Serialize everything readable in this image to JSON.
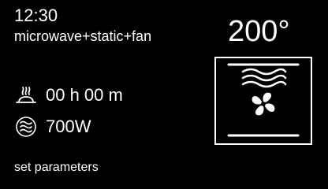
{
  "status": {
    "time": "12:30",
    "mode": "microwave+static+fan",
    "temperature": "200°"
  },
  "settings": {
    "duration": "00 h 00 m",
    "power": "700W"
  },
  "footer": {
    "hint": "set parameters"
  },
  "icons": {
    "duration": "dish-timer-icon",
    "power": "microwave-waves-icon",
    "oven": "oven-fan-heating-icon"
  },
  "colors": {
    "background": "#000000",
    "foreground": "#ffffff"
  }
}
